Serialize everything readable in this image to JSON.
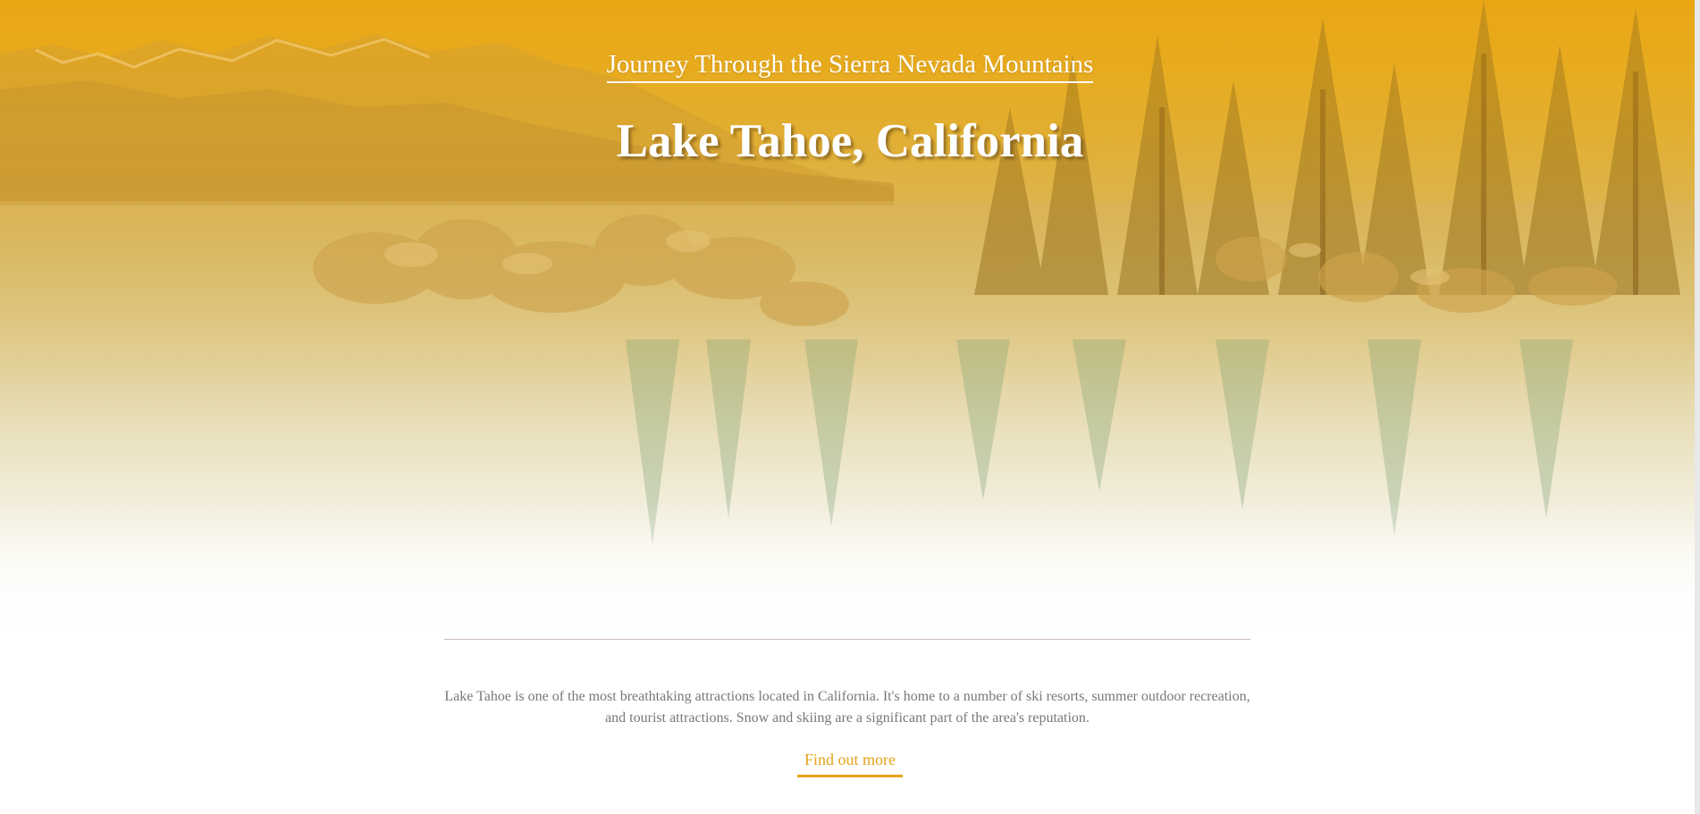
{
  "hero": {
    "subtitle": "Journey Through the Sierra Nevada Mountains",
    "title": "Lake Tahoe, California",
    "background": "lake-tahoe-landscape"
  },
  "content": {
    "description": "Lake Tahoe is one of the most breathtaking attractions located in California. It's home to a number of ski resorts, summer outdoor recreation, and tourist attractions. Snow and skiing are a significant part of the area's reputation.",
    "cta_label": "Find out more"
  },
  "colors": {
    "accent": "#e6a31a",
    "hero_tint": "#e6a516",
    "text_muted": "#777777",
    "divider": "#c7b8b8"
  }
}
